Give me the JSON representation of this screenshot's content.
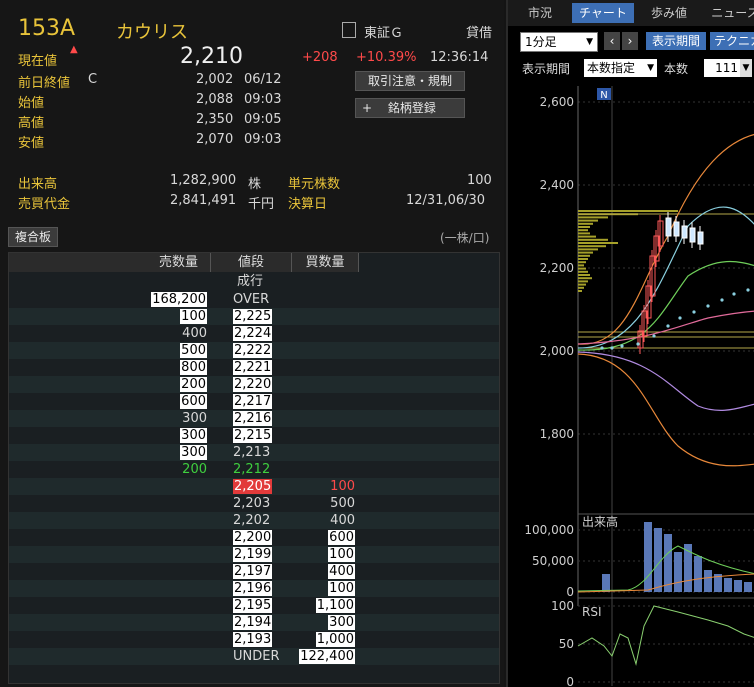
{
  "stock": {
    "code": "153A",
    "name": "カウリス",
    "market": "東証Ｇ",
    "margin": "貸借",
    "current_label": "現在値",
    "current_price": "2,210",
    "change": "+208",
    "change_pct": "+10.39%",
    "time": "12:36:14",
    "prev_close_label": "前日終値",
    "prev_close_flag": "C",
    "prev_close": "2,002",
    "prev_close_date": "06/12",
    "open_label": "始値",
    "open": "2,088",
    "open_time": "09:03",
    "high_label": "高値",
    "high": "2,350",
    "high_time": "09:05",
    "low_label": "安値",
    "low": "2,070",
    "low_time": "09:03",
    "volume_label": "出来高",
    "volume": "1,282,900",
    "volume_unit": "株",
    "unit_shares_label": "単元株数",
    "unit_shares": "100",
    "turnover_label": "売買代金",
    "turnover": "2,841,491",
    "turnover_unit": "千円",
    "settlement_label": "決算日",
    "settlement": "12/31,06/30"
  },
  "buttons": {
    "trading_notes": "取引注意・規制",
    "register": "銘柄登録",
    "register_icon": "+",
    "composite_board": "複合板",
    "unit_note": "(一株/口)"
  },
  "book": {
    "headers": [
      "売数量",
      "値段",
      "買数量"
    ],
    "market_order": "成行",
    "rows": [
      {
        "sell": "168,200",
        "price": "OVER",
        "buy": ""
      },
      {
        "sell": "100",
        "price": "2,225",
        "buy": ""
      },
      {
        "sell": "400",
        "price": "2,224",
        "buy": ""
      },
      {
        "sell": "500",
        "price": "2,222",
        "buy": ""
      },
      {
        "sell": "800",
        "price": "2,221",
        "buy": ""
      },
      {
        "sell": "200",
        "price": "2,220",
        "buy": ""
      },
      {
        "sell": "600",
        "price": "2,217",
        "buy": ""
      },
      {
        "sell": "300",
        "price": "2,216",
        "buy": ""
      },
      {
        "sell": "300",
        "price": "2,215",
        "buy": ""
      },
      {
        "sell": "300",
        "price": "2,213",
        "buy": ""
      },
      {
        "sell": "200",
        "price": "2,212",
        "buy": ""
      },
      {
        "sell": "",
        "price": "2,205",
        "buy": "100"
      },
      {
        "sell": "",
        "price": "2,203",
        "buy": "500"
      },
      {
        "sell": "",
        "price": "2,202",
        "buy": "400"
      },
      {
        "sell": "",
        "price": "2,200",
        "buy": "600"
      },
      {
        "sell": "",
        "price": "2,199",
        "buy": "100"
      },
      {
        "sell": "",
        "price": "2,197",
        "buy": "400"
      },
      {
        "sell": "",
        "price": "2,196",
        "buy": "100"
      },
      {
        "sell": "",
        "price": "2,195",
        "buy": "1,100"
      },
      {
        "sell": "",
        "price": "2,194",
        "buy": "300"
      },
      {
        "sell": "",
        "price": "2,193",
        "buy": "1,000"
      },
      {
        "sell": "",
        "price": "UNDER",
        "buy": "122,400"
      }
    ]
  },
  "right": {
    "tabs": [
      "市況",
      "チャート",
      "歩み値",
      "ニュース"
    ],
    "active_tab": 1,
    "interval": "1分足",
    "prev_icon": "‹",
    "next_icon": "›",
    "display_period_btn": "表示期間",
    "technical_btn": "テクニカ",
    "period_label": "表示期間",
    "period_value": "本数指定",
    "count_label": "本数",
    "count_value": "111",
    "n_marker": "N",
    "price_ticks": [
      "2,600",
      "2,400",
      "2,200",
      "2,000",
      "1,800"
    ],
    "volume_label": "出来高",
    "volume_ticks": [
      "100,000",
      "50,000",
      "0"
    ],
    "rsi_label": "RSI",
    "rsi_ticks": [
      "100",
      "50",
      "0"
    ]
  },
  "colors": {
    "up": "#ff4a4a",
    "accent_yellow": "#e9c43a",
    "buy_highlight": "#e23a3a",
    "green": "#3fcf3f"
  }
}
